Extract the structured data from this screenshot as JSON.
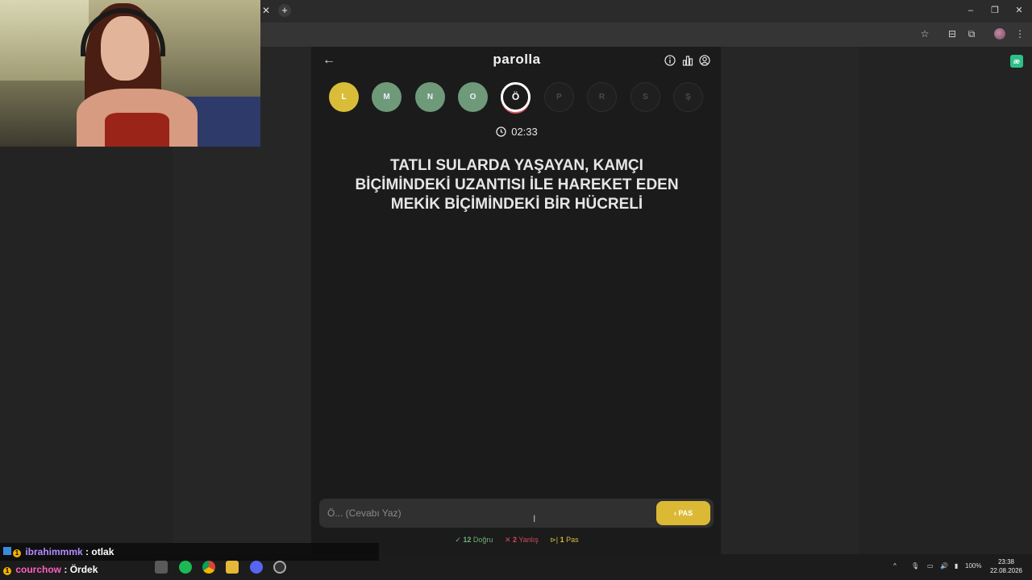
{
  "app": {
    "logo": "parolla"
  },
  "letters": [
    {
      "char": "L",
      "state": "yellow"
    },
    {
      "char": "M",
      "state": "green"
    },
    {
      "char": "N",
      "state": "green"
    },
    {
      "char": "O",
      "state": "green"
    },
    {
      "char": "Ö",
      "state": "active"
    },
    {
      "char": "P",
      "state": "pending"
    },
    {
      "char": "R",
      "state": "pending"
    },
    {
      "char": "S",
      "state": "pending"
    },
    {
      "char": "Ş",
      "state": "pending"
    }
  ],
  "timer": "02:33",
  "question": "TATLI SULARDA YAŞAYAN, KAMÇI BİÇİMİNDEKİ UZANTISI İLE HAREKET EDEN MEKİK BİÇİMİNDEKİ BİR HÜCRELİ",
  "answer": {
    "placeholder": "Ö... (Cevabı Yaz)",
    "value": "",
    "pas_label": "PAS"
  },
  "stats": {
    "correct_count": "12",
    "correct_label": "Doğru",
    "wrong_count": "2",
    "wrong_label": "Yanlış",
    "pas_count": "1",
    "pas_label": "Pas"
  },
  "chat": [
    {
      "user": "ibrahimmmk",
      "message": ": otlak"
    },
    {
      "user": "courchow",
      "message": ": Ördek"
    }
  ],
  "taskbar": {
    "battery": "100%",
    "time": "23:38",
    "date": "22.08.2026"
  },
  "colors": {
    "yellow": "#d9bd39",
    "green": "#6e9a79",
    "wrong": "#d24b5a",
    "active_ring": "#ffffff"
  }
}
